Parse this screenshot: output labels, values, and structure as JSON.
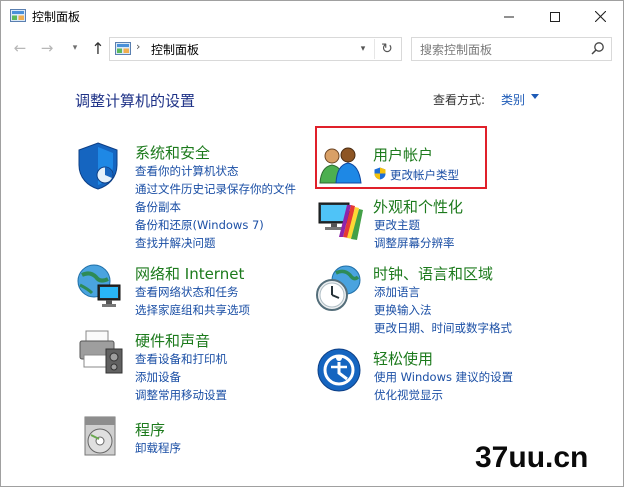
{
  "window": {
    "title": "控制面板"
  },
  "titlebar": {
    "minimize_icon": "minimize-icon",
    "maximize_icon": "maximize-icon",
    "close_icon": "close-icon"
  },
  "nav": {
    "address_path": "控制面板",
    "address_separator": "›"
  },
  "search": {
    "placeholder": "搜索控制面板"
  },
  "header": {
    "title": "调整计算机的设置",
    "view_by_label": "查看方式:",
    "view_by_value": "类别"
  },
  "categories": [
    {
      "title": "系统和安全",
      "icon": "shield-icon",
      "links": [
        "查看你的计算机状态",
        "通过文件历史记录保存你的文件",
        "备份副本",
        "备份和还原(Windows 7)",
        "查找并解决问题"
      ]
    },
    {
      "title": "网络和 Internet",
      "icon": "network-icon",
      "links": [
        "查看网络状态和任务",
        "选择家庭组和共享选项"
      ]
    },
    {
      "title": "硬件和声音",
      "icon": "printer-icon",
      "links": [
        "查看设备和打印机",
        "添加设备",
        "调整常用移动设置"
      ]
    },
    {
      "title": "程序",
      "icon": "programs-icon",
      "links": [
        "卸载程序"
      ]
    },
    {
      "title": "用户帐户",
      "icon": "users-icon",
      "links": [
        "更改帐户类型"
      ]
    },
    {
      "title": "外观和个性化",
      "icon": "appearance-icon",
      "links": [
        "更改主题",
        "调整屏幕分辨率"
      ]
    },
    {
      "title": "时钟、语言和区域",
      "icon": "clock-globe-icon",
      "links": [
        "添加语言",
        "更换输入法",
        "更改日期、时间或数字格式"
      ]
    },
    {
      "title": "轻松使用",
      "icon": "ease-of-access-icon",
      "links": [
        "使用 Windows 建议的设置",
        "优化视觉显示"
      ]
    }
  ],
  "colors": {
    "title_green": "#1c7a1c",
    "link_blue": "#1b4fa5",
    "header_blue": "#1e3287",
    "highlight_red": "#e0202a"
  },
  "watermark": "37uu.cn"
}
